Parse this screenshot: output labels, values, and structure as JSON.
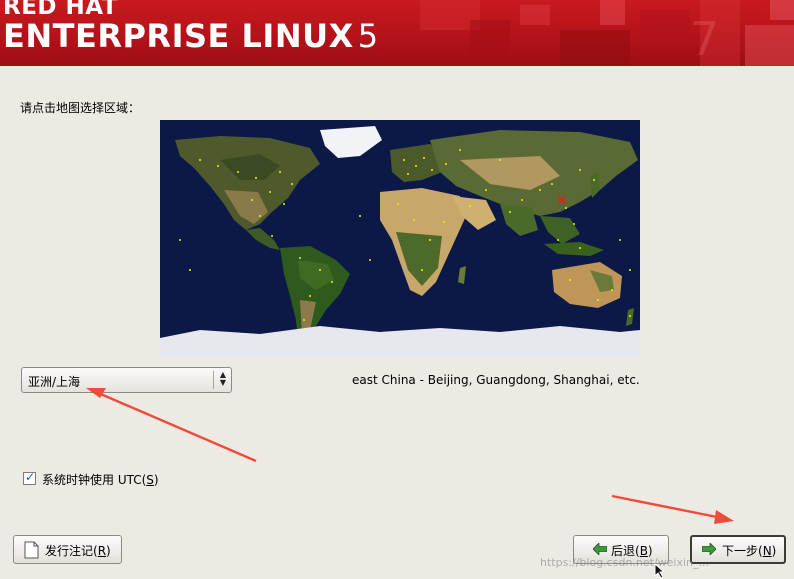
{
  "header": {
    "brand_line1": "RED HAT",
    "brand_line2": "ENTERPRISE LINUX",
    "version": "5",
    "accent_color": "#c0161c"
  },
  "prompt": "请点击地图选择区域：",
  "map": {
    "selected_marker_color": "#e02020",
    "city_dot_color": "#f4f000"
  },
  "timezone": {
    "selected": "亚洲/上海",
    "description": "east China - Beijing, Guangdong, Shanghai, etc."
  },
  "utc_checkbox": {
    "checked": true,
    "label_prefix": "系统时钟使用 UTC(",
    "mnemonic": "S",
    "label_suffix": ")"
  },
  "buttons": {
    "release_notes": {
      "prefix": "发行注记(",
      "mnemonic": "R",
      "suffix": ")",
      "icon": "document-icon"
    },
    "back": {
      "prefix": "后退(",
      "mnemonic": "B",
      "suffix": ")",
      "icon": "arrow-left-icon"
    },
    "next": {
      "prefix": "下一步(",
      "mnemonic": "N",
      "suffix": ")",
      "icon": "arrow-right-icon"
    }
  },
  "watermark": "https://blog.csdn.net/weixin_..."
}
